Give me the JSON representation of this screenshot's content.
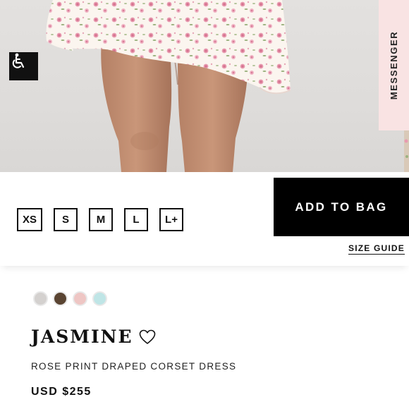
{
  "hero": {
    "accessibility_icon": "accessibility-wheelchair-icon",
    "messenger_label": "MESSENGER"
  },
  "sizes": [
    "XS",
    "S",
    "M",
    "L",
    "L+"
  ],
  "actions": {
    "add_to_bag": "ADD TO BAG",
    "size_guide": "SIZE GUIDE"
  },
  "swatches": [
    {
      "color": "#d4d1cf"
    },
    {
      "color": "#5a4432"
    },
    {
      "color": "#eec6c4"
    },
    {
      "color": "#bfe5e6"
    }
  ],
  "product": {
    "name": "JASMINE",
    "favorite_icon": "heart-outline-icon",
    "subtitle": "ROSE PRINT DRAPED CORSET DRESS",
    "price": "USD $255"
  },
  "colors": {
    "accent": "#000000",
    "messenger_bg": "#f9e3e3",
    "dress_pink": "#e89ab0",
    "dress_base": "#fbf5ef"
  }
}
